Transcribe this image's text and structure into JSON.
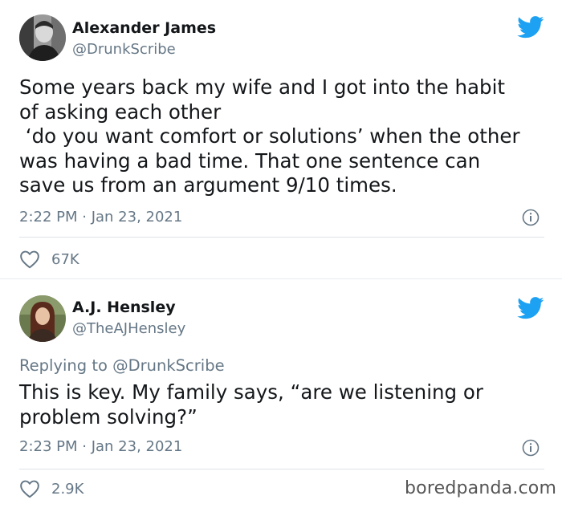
{
  "tweets": [
    {
      "name": "Alexander James",
      "handle": "@DrunkScribe",
      "text_lines": [
        "Some years back my wife and I got into the habit",
        "of asking each other",
        " ‘do you want comfort or solutions’ when the other",
        "was having a bad time. That one sentence can",
        "save us from an argument 9/10 times."
      ],
      "timestamp": "2:22 PM · Jan 23, 2021",
      "likes": "67K"
    },
    {
      "name": "A.J. Hensley",
      "handle": "@TheAJHensley",
      "replying_prefix": "Replying to ",
      "replying_to": "@DrunkScribe",
      "text_lines": [
        "This is key. My family says, “are we listening or",
        "problem solving?”"
      ],
      "timestamp": "2:23 PM · Jan 23, 2021",
      "likes": "2.9K"
    }
  ],
  "watermark": "boredpanda.com",
  "icons": {
    "platform": "twitter-bird-icon",
    "info": "info-icon",
    "like": "heart-icon"
  },
  "colors": {
    "twitter_blue": "#1da1f2",
    "text": "#14171a",
    "secondary": "#657786",
    "divider": "#e6ecf0"
  }
}
